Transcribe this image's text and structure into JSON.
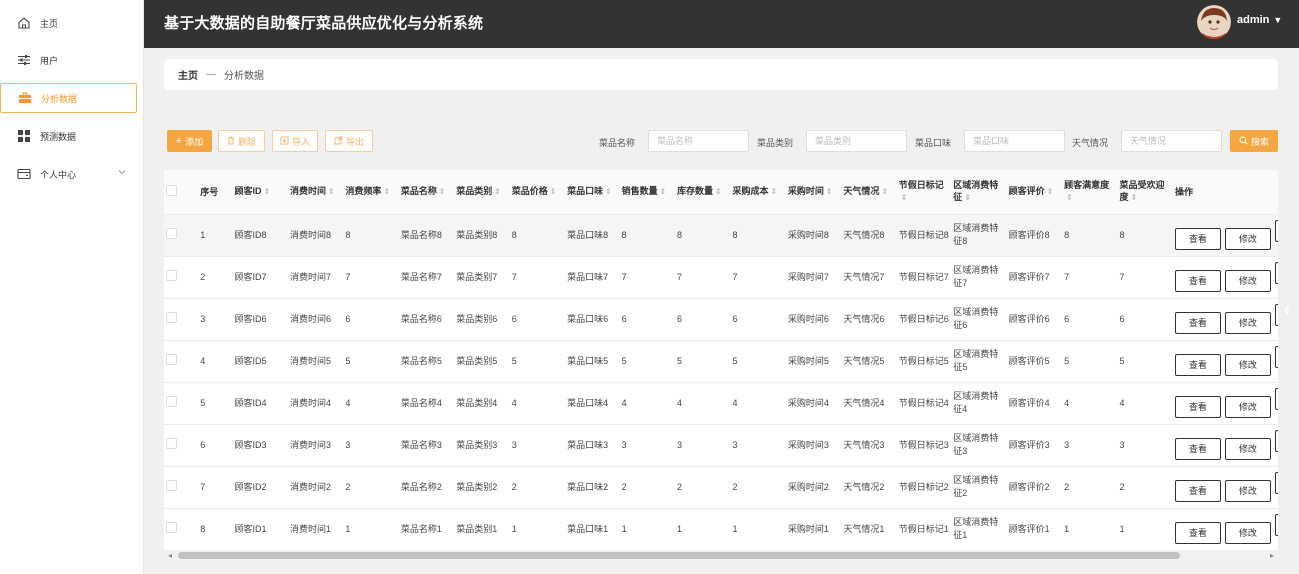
{
  "sidebar": {
    "items": [
      {
        "label": "主页",
        "icon": "home-icon"
      },
      {
        "label": "用户",
        "icon": "sliders-icon"
      },
      {
        "label": "分析数据",
        "icon": "briefcase-icon"
      },
      {
        "label": "预测数据",
        "icon": "grid-icon"
      },
      {
        "label": "个人中心",
        "icon": "wallet-icon"
      }
    ]
  },
  "header": {
    "title": "基于大数据的自助餐厅菜品供应优化与分析系统",
    "user": "admin"
  },
  "breadcrumb": {
    "home": "主页",
    "sep": "—",
    "current": "分析数据"
  },
  "toolbar": {
    "add": "添加",
    "delete": "删除",
    "import": "导入",
    "export": "导出",
    "search": "搜索",
    "filters": [
      {
        "label": "菜品名称",
        "placeholder": "菜品名称"
      },
      {
        "label": "菜品类别",
        "placeholder": "菜品类别"
      },
      {
        "label": "菜品口味",
        "placeholder": "菜品口味"
      },
      {
        "label": "天气情况",
        "placeholder": "天气情况"
      }
    ]
  },
  "table": {
    "headers": [
      "序号",
      "顾客ID",
      "消费时间",
      "消费频率",
      "菜品名称",
      "菜品类别",
      "菜品价格",
      "菜品口味",
      "销售数量",
      "库存数量",
      "采购成本",
      "采购时间",
      "天气情况",
      "节假日标记",
      "区域消费特征",
      "顾客评价",
      "顾客满意度",
      "菜品受欢迎度",
      "操作"
    ],
    "view_label": "查看",
    "edit_label": "修改",
    "rows": [
      [
        "1",
        "顾客ID8",
        "消费时间8",
        "8",
        "菜品名称8",
        "菜品类别8",
        "8",
        "菜品口味8",
        "8",
        "8",
        "8",
        "采购时间8",
        "天气情况8",
        "节假日标记8",
        "区域消费特征8",
        "顾客评价8",
        "8",
        "8"
      ],
      [
        "2",
        "顾客ID7",
        "消费时间7",
        "7",
        "菜品名称7",
        "菜品类别7",
        "7",
        "菜品口味7",
        "7",
        "7",
        "7",
        "采购时间7",
        "天气情况7",
        "节假日标记7",
        "区域消费特征7",
        "顾客评价7",
        "7",
        "7"
      ],
      [
        "3",
        "顾客ID6",
        "消费时间6",
        "6",
        "菜品名称6",
        "菜品类别6",
        "6",
        "菜品口味6",
        "6",
        "6",
        "6",
        "采购时间6",
        "天气情况6",
        "节假日标记6",
        "区域消费特征6",
        "顾客评价6",
        "6",
        "6"
      ],
      [
        "4",
        "顾客ID5",
        "消费时间5",
        "5",
        "菜品名称5",
        "菜品类别5",
        "5",
        "菜品口味5",
        "5",
        "5",
        "5",
        "采购时间5",
        "天气情况5",
        "节假日标记5",
        "区域消费特征5",
        "顾客评价5",
        "5",
        "5"
      ],
      [
        "5",
        "顾客ID4",
        "消费时间4",
        "4",
        "菜品名称4",
        "菜品类别4",
        "4",
        "菜品口味4",
        "4",
        "4",
        "4",
        "采购时间4",
        "天气情况4",
        "节假日标记4",
        "区域消费特征4",
        "顾客评价4",
        "4",
        "4"
      ],
      [
        "6",
        "顾客ID3",
        "消费时间3",
        "3",
        "菜品名称3",
        "菜品类别3",
        "3",
        "菜品口味3",
        "3",
        "3",
        "3",
        "采购时间3",
        "天气情况3",
        "节假日标记3",
        "区域消费特征3",
        "顾客评价3",
        "3",
        "3"
      ],
      [
        "7",
        "顾客ID2",
        "消费时间2",
        "2",
        "菜品名称2",
        "菜品类别2",
        "2",
        "菜品口味2",
        "2",
        "2",
        "2",
        "采购时间2",
        "天气情况2",
        "节假日标记2",
        "区域消费特征2",
        "顾客评价2",
        "2",
        "2"
      ],
      [
        "8",
        "顾客ID1",
        "消费时间1",
        "1",
        "菜品名称1",
        "菜品类别1",
        "1",
        "菜品口味1",
        "1",
        "1",
        "1",
        "采购时间1",
        "天气情况1",
        "节假日标记1",
        "区域消费特征1",
        "顾客评价1",
        "1",
        "1"
      ]
    ]
  },
  "colors": {
    "accent": "#f5a640",
    "header_bg": "#333333"
  }
}
